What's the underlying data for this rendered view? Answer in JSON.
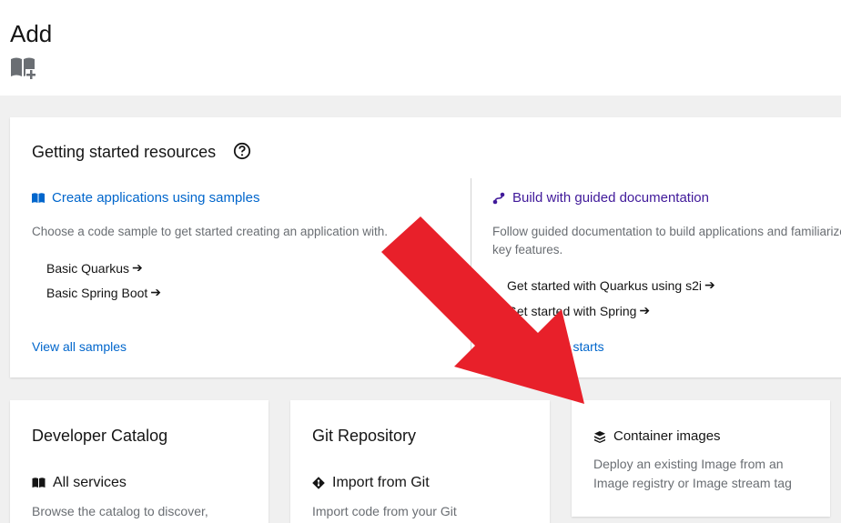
{
  "page": {
    "title": "Add"
  },
  "getting_started": {
    "title": "Getting started resources",
    "samples": {
      "heading": "Create applications using samples",
      "description": "Choose a code sample to get started creating an application with.",
      "items": [
        "Basic Quarkus",
        "Basic Spring Boot"
      ],
      "view_all": "View all samples"
    },
    "docs": {
      "heading": "Build with guided documentation",
      "description_line1": "Follow guided documentation to build applications and familiarize y",
      "description_line2": "key features.",
      "items": [
        "Get started with Quarkus using s2i",
        "Get started with Spring"
      ],
      "view_all": "View all quick starts"
    }
  },
  "cards": {
    "developer_catalog": {
      "title": "Developer Catalog",
      "sub_heading": "All services",
      "description": "Browse the catalog to discover,"
    },
    "git_repository": {
      "title": "Git Repository",
      "sub_heading": "Import from Git",
      "description": "Import code from your Git"
    },
    "container_images": {
      "title": "Container images",
      "description_line1": "Deploy an existing Image from an",
      "description_line2": "Image registry or Image stream tag"
    }
  },
  "icons": {
    "page_icon": "book-add-icon",
    "help": "question-circle-icon",
    "samples": "book-open-icon",
    "docs": "route-icon",
    "git": "git-diamond-icon",
    "container": "cube-stack-icon",
    "link_arrow": "arrow-right-icon"
  },
  "colors": {
    "link": "#0066cc",
    "docs_heading": "#40199a",
    "annotation_arrow": "#e8202a"
  }
}
